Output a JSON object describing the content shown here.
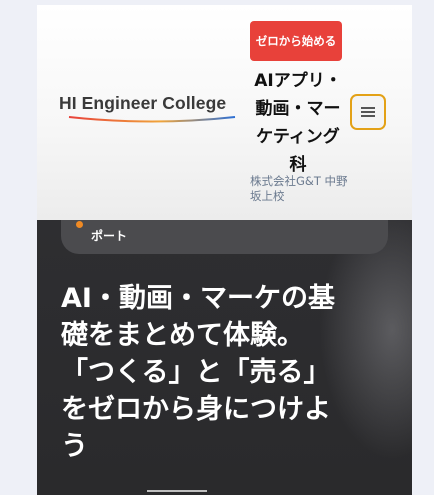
{
  "header": {
    "logo_text": "HI Engineer College",
    "cta_badge": "ゼロから始める",
    "course_title": "AIアプリ・動画・マーケティング科",
    "school_name": "株式会社G&T 中野坂上校"
  },
  "hero": {
    "tag": "ポート",
    "heading_lines": [
      "AI・動画・マーケの基",
      "礎をまとめて体験。",
      "「つくる」と「売る」",
      "をゼロから身につけよ",
      "う"
    ]
  },
  "colors": {
    "cta": "#e8413a",
    "menu_border": "#e3a116",
    "tag_dot": "#f08a24",
    "logo_swoosh_start": "#e8413a",
    "logo_swoosh_end": "#2b6fd6"
  },
  "icons": {
    "menu": "hamburger-icon"
  }
}
